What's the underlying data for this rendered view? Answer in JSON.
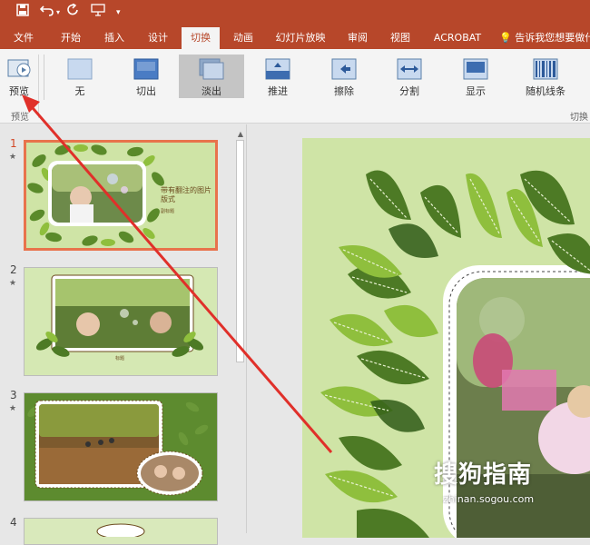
{
  "quick_access": {
    "save_icon": "save-icon",
    "undo_icon": "undo-icon",
    "redo_icon": "redo-icon",
    "start_from_beginning_icon": "present-icon"
  },
  "tabs": [
    {
      "label": "文件"
    },
    {
      "label": "开始"
    },
    {
      "label": "插入"
    },
    {
      "label": "设计"
    },
    {
      "label": "切换",
      "active": true
    },
    {
      "label": "动画"
    },
    {
      "label": "幻灯片放映"
    },
    {
      "label": "审阅"
    },
    {
      "label": "视图"
    },
    {
      "label": "ACROBAT"
    }
  ],
  "tell_me": "告诉我您想要做什",
  "ribbon": {
    "preview_label": "预览",
    "preview_group_label": "预览",
    "transitions_group_label": "切换",
    "transitions": [
      {
        "label": "无"
      },
      {
        "label": "切出"
      },
      {
        "label": "淡出",
        "selected": true
      },
      {
        "label": "推进"
      },
      {
        "label": "擦除"
      },
      {
        "label": "分割"
      },
      {
        "label": "显示"
      },
      {
        "label": "随机线条"
      }
    ]
  },
  "slides": [
    {
      "number": "1",
      "star": "★",
      "title": "带有翻注的图片版式",
      "subtitle": "副标题"
    },
    {
      "number": "2",
      "star": "★",
      "caption": "标题"
    },
    {
      "number": "3",
      "star": "★"
    },
    {
      "number": "4"
    }
  ],
  "watermark": {
    "text": "搜狗指南",
    "url": "zhinan.sogou.com"
  },
  "colors": {
    "brand": "#b7472a",
    "leaf_dark": "#4d7a25",
    "leaf_light": "#8fbf3d",
    "slide_bg": "#cfe4a6",
    "arrow": "#e0302a"
  }
}
